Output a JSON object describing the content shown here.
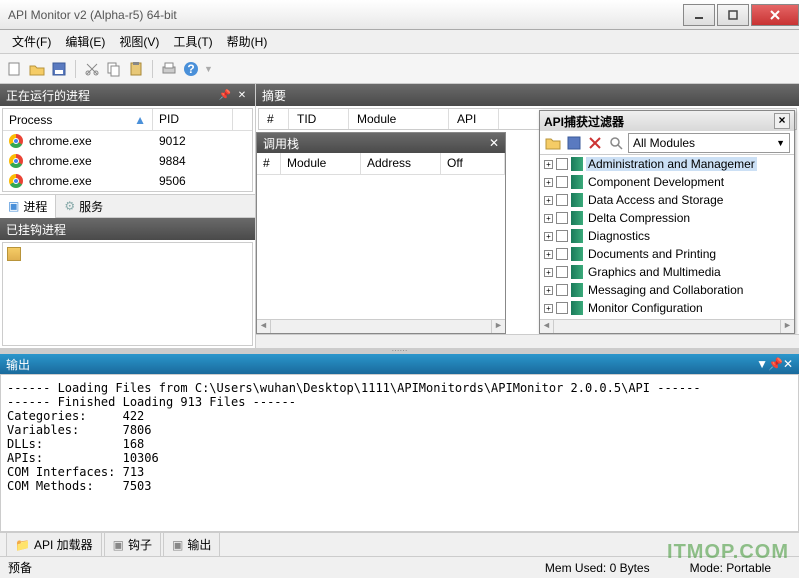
{
  "window": {
    "title": "API Monitor v2 (Alpha-r5) 64-bit"
  },
  "menu": {
    "file": "文件(F)",
    "edit": "编辑(E)",
    "view": "视图(V)",
    "tools": "工具(T)",
    "help": "帮助(H)"
  },
  "panels": {
    "running": "正在运行的进程",
    "hooked": "已挂钩进程",
    "summary": "摘要",
    "callstack": "调用栈",
    "filter": "API捕获过滤器",
    "output": "输出"
  },
  "process_cols": {
    "process": "Process",
    "pid": "PID"
  },
  "processes": [
    {
      "name": "chrome.exe",
      "pid": "9012"
    },
    {
      "name": "chrome.exe",
      "pid": "9884"
    },
    {
      "name": "chrome.exe",
      "pid": "9506"
    }
  ],
  "tabs": {
    "process": "进程",
    "service": "服务"
  },
  "summary_cols": {
    "num": "#",
    "tid": "TID",
    "module": "Module",
    "api": "API"
  },
  "callstack_cols": {
    "num": "#",
    "module": "Module",
    "address": "Address",
    "off": "Off"
  },
  "filter": {
    "dropdown": "All Modules",
    "items": [
      "Administration and Managemer",
      "Component Development",
      "Data Access and Storage",
      "Delta Compression",
      "Diagnostics",
      "Documents and Printing",
      "Graphics and Multimedia",
      "Messaging and Collaboration",
      "Monitor Configuration"
    ]
  },
  "output_lines": [
    "------ Loading Files from C:\\Users\\wuhan\\Desktop\\1111\\APIMonitords\\APIMonitor 2.0.0.5\\API ------",
    "------ Finished Loading 913 Files ------",
    "Categories:     422",
    "Variables:      7806",
    "DLLs:           168",
    "APIs:           10306",
    "COM Interfaces: 713",
    "COM Methods:    7503"
  ],
  "bottom_tabs": {
    "loader": "API 加载器",
    "hooks": "钩子",
    "output": "输出"
  },
  "status": {
    "ready": "预备",
    "mem": "Mem Used: 0 Bytes",
    "mode": "Mode: Portable"
  },
  "watermark": "ITMOP.COM"
}
